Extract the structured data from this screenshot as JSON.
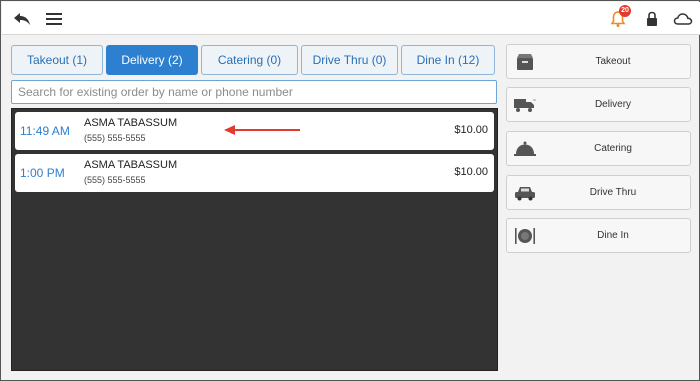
{
  "topbar": {
    "notification_count": "20",
    "icons": [
      "back-arrow-icon",
      "hamburger-menu-icon",
      "bell-icon",
      "lock-icon",
      "cloud-icon"
    ]
  },
  "tabs": [
    {
      "label": "Takeout (1)",
      "active": false
    },
    {
      "label": "Delivery (2)",
      "active": true
    },
    {
      "label": "Catering (0)",
      "active": false
    },
    {
      "label": "Drive Thru (0)",
      "active": false
    },
    {
      "label": "Dine In (12)",
      "active": false
    }
  ],
  "search": {
    "placeholder": "Search for existing order by name or phone number",
    "value": ""
  },
  "orders": [
    {
      "time": "11:49 AM",
      "name": "ASMA TABASSUM",
      "phone": "(555) 555-5555",
      "amount": "$10.00"
    },
    {
      "time": "1:00 PM",
      "name": "ASMA TABASSUM",
      "phone": "(555) 555-5555",
      "amount": "$10.00"
    }
  ],
  "order_types": [
    {
      "label": "Takeout",
      "icon": "takeout-bag-icon"
    },
    {
      "label": "Delivery",
      "icon": "delivery-truck-icon"
    },
    {
      "label": "Catering",
      "icon": "catering-cloche-icon"
    },
    {
      "label": "Drive Thru",
      "icon": "car-icon"
    },
    {
      "label": "Dine In",
      "icon": "plate-cutlery-icon"
    }
  ],
  "colors": {
    "accent": "#2d7fd0",
    "annotation_arrow": "#e23b2e",
    "order_list_bg": "#333333",
    "badge": "#e23b2e"
  }
}
